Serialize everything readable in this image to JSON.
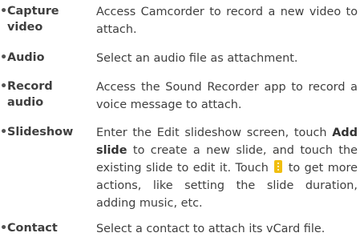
{
  "items": [
    {
      "bullet": "•",
      "term": "Capture video",
      "description": "Access Camcorder to record a new video to attach."
    },
    {
      "bullet": "•",
      "term": "Audio",
      "description": "Select an audio file as attachment."
    },
    {
      "bullet": "•",
      "term": "Record audio",
      "description": "Access the Sound Recorder app to record a voice message to attach."
    },
    {
      "bullet": "•",
      "term": "Slideshow",
      "description_part1": "Enter the Edit slideshow screen, touch ",
      "description_bold": "Add slide",
      "description_part2": " to create a new slide, and touch the existing slide to edit it. Touch ",
      "icon": "more-options-icon",
      "description_part3": " to get more actions, like setting the slide duration, adding music, etc."
    },
    {
      "bullet": "•",
      "term": "Contact",
      "description": "Select a contact to attach its vCard file."
    }
  ],
  "colors": {
    "text": "#3f3f3f",
    "icon_accent": "#f0be0e"
  }
}
